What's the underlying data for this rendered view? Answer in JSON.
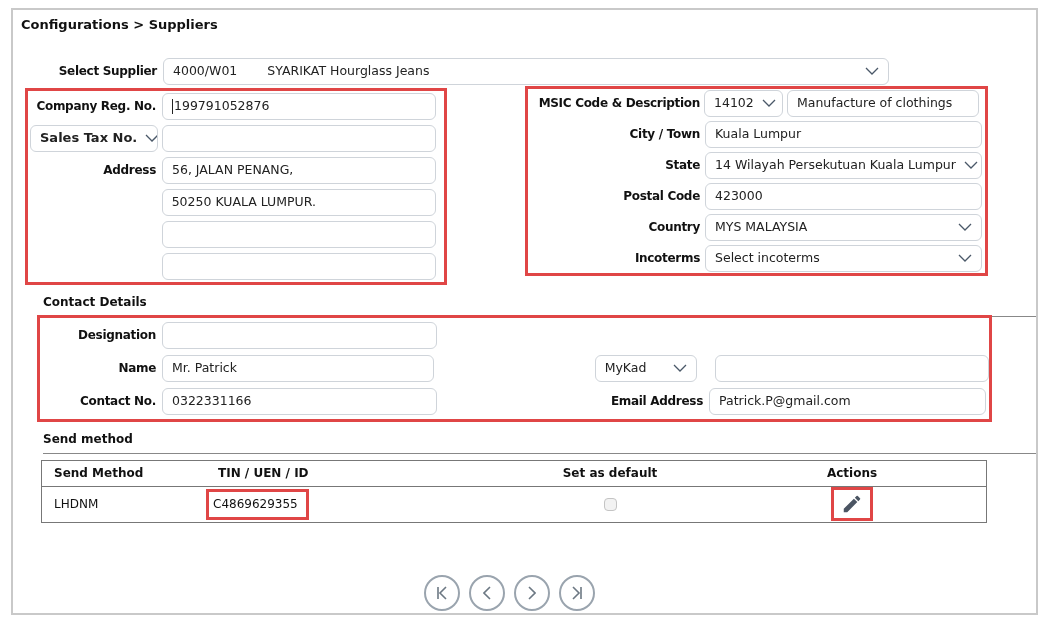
{
  "breadcrumb": "Configurations > Suppliers",
  "supplier": {
    "label": "Select Supplier",
    "code": "4000/W01",
    "name": "SYARIKAT Hourglass Jeans"
  },
  "company": {
    "highlighted": true,
    "reg": {
      "label": "Company Reg. No.",
      "value": "199791052876",
      "focused": true
    },
    "tax": {
      "label": "Sales Tax No."
    },
    "address": {
      "label": "Address",
      "lines": [
        "56, JALAN PENANG,",
        "50250 KUALA LUMPUR."
      ]
    }
  },
  "location": {
    "highlighted": true,
    "msic": {
      "label": "MSIC Code & Description",
      "code": "14102",
      "description": "Manufacture of clothings"
    },
    "rows": [
      {
        "kind": "text",
        "label": "City / Town",
        "value": "Kuala Lumpur"
      },
      {
        "kind": "select",
        "label": "State",
        "value": "14 Wilayah Persekutuan Kuala Lumpur"
      },
      {
        "kind": "text",
        "label": "Postal Code",
        "value": "423000"
      },
      {
        "kind": "select",
        "label": "Country",
        "value": "MYS MALAYSIA"
      },
      {
        "kind": "select",
        "label": "Incoterms",
        "placeholder": "Select incoterms"
      }
    ]
  },
  "contact": {
    "heading": "Contact Details",
    "highlighted": true,
    "designation": {
      "label": "Designation"
    },
    "name": {
      "label": "Name",
      "value": "Mr. Patrick"
    },
    "id_type": {
      "value": "MyKad"
    },
    "contact_no": {
      "label": "Contact No.",
      "value": "0322331166"
    },
    "email": {
      "label": "Email Address",
      "value": "Patrick.P@gmail.com"
    }
  },
  "send_method": {
    "heading": "Send method",
    "columns": [
      "Send Method",
      "TIN / UEN / ID",
      "Set as default",
      "Actions"
    ],
    "rows": [
      {
        "method": "LHDNM",
        "tin": "C4869629355",
        "tin_highlighted": true,
        "default": {
          "checked": false,
          "disabled": true
        },
        "edit_highlighted": true
      }
    ]
  }
}
